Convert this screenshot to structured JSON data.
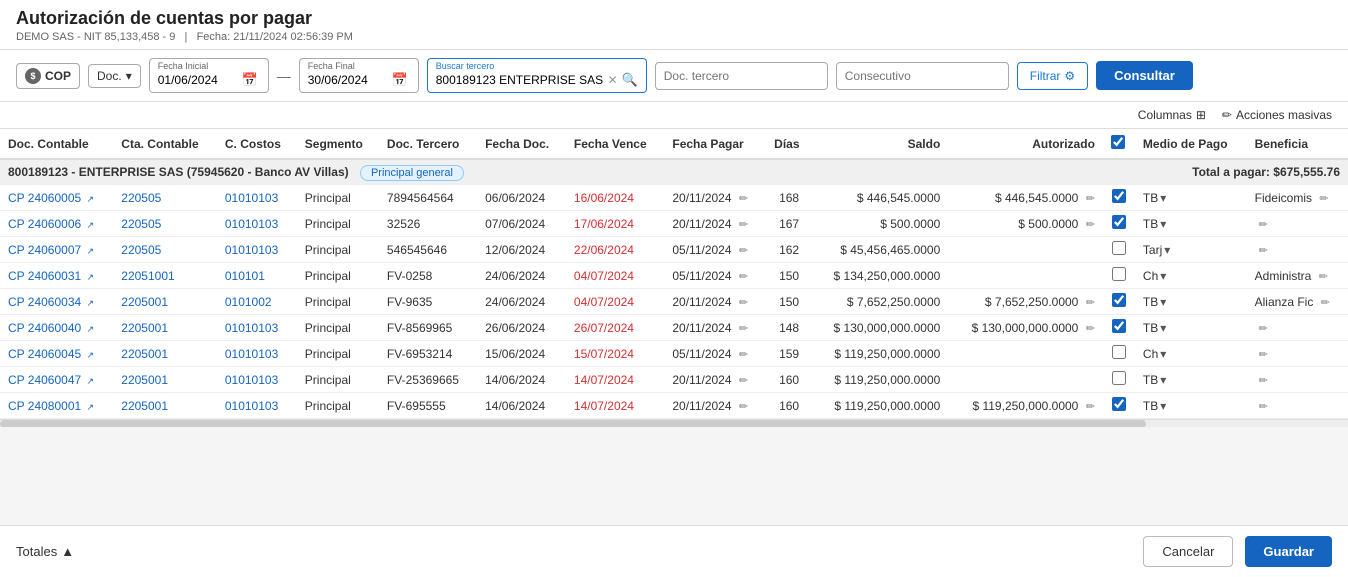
{
  "page": {
    "title": "Autorización de cuentas por pagar",
    "subtitle_company": "DEMO SAS - NIT 85,133,458 - 9",
    "subtitle_date": "Fecha: 21/11/2024 02:56:39 PM"
  },
  "toolbar": {
    "currency": "COP",
    "doc_type": "Doc.",
    "fecha_inicial_label": "Fecha Inicial",
    "fecha_inicial_value": "01/06/2024",
    "fecha_final_label": "Fecha Final",
    "fecha_final_value": "30/06/2024",
    "buscar_tercero_label": "Buscar tercero",
    "buscar_tercero_value": "800189123 ENTERPRISE SAS",
    "doc_tercero_placeholder": "Doc. tercero",
    "consecutivo_placeholder": "Consecutivo",
    "filtrar_label": "Filtrar",
    "consultar_label": "Consultar"
  },
  "action_bar": {
    "columns_label": "Columnas",
    "acciones_label": "Acciones masivas"
  },
  "table": {
    "columns": [
      "Doc. Contable",
      "Cta. Contable",
      "C. Costos",
      "Segmento",
      "Doc. Tercero",
      "Fecha Doc.",
      "Fecha Vence",
      "Fecha Pagar",
      "Días",
      "Saldo",
      "Autorizado",
      "",
      "Medio de Pago",
      "Beneficia"
    ],
    "group": {
      "label": "800189123 - ENTERPRISE SAS (75945620 - Banco AV Villas)",
      "badge": "Principal general",
      "total": "Total a pagar: $675,555.76"
    },
    "rows": [
      {
        "doc_contable": "CP 24060005",
        "cta_contable": "220505",
        "c_costos": "01010103",
        "segmento": "Principal",
        "doc_tercero": "7894564564",
        "fecha_doc": "06/06/2024",
        "fecha_vence": "16/06/2024",
        "fecha_vence_red": true,
        "fecha_pagar": "20/11/2024",
        "dias": "168",
        "saldo": "$ 446,545.0000",
        "autorizado": "$ 446,545.0000",
        "checked": true,
        "medio_pago": "TB",
        "beneficia": "Fideicomis"
      },
      {
        "doc_contable": "CP 24060006",
        "cta_contable": "220505",
        "c_costos": "01010103",
        "segmento": "Principal",
        "doc_tercero": "32526",
        "fecha_doc": "07/06/2024",
        "fecha_vence": "17/06/2024",
        "fecha_vence_red": true,
        "fecha_pagar": "20/11/2024",
        "dias": "167",
        "saldo": "$ 500.0000",
        "autorizado": "$ 500.0000",
        "checked": true,
        "medio_pago": "TB",
        "beneficia": ""
      },
      {
        "doc_contable": "CP 24060007",
        "cta_contable": "220505",
        "c_costos": "01010103",
        "segmento": "Principal",
        "doc_tercero": "546545646",
        "fecha_doc": "12/06/2024",
        "fecha_vence": "22/06/2024",
        "fecha_vence_red": true,
        "fecha_pagar": "05/11/2024",
        "dias": "162",
        "saldo": "$ 45,456,465.0000",
        "autorizado": "",
        "checked": false,
        "medio_pago": "Tarj",
        "beneficia": ""
      },
      {
        "doc_contable": "CP 24060031",
        "cta_contable": "22051001",
        "c_costos": "010101",
        "segmento": "Principal",
        "doc_tercero": "FV-0258",
        "fecha_doc": "24/06/2024",
        "fecha_vence": "04/07/2024",
        "fecha_vence_red": true,
        "fecha_pagar": "05/11/2024",
        "dias": "150",
        "saldo": "$ 134,250,000.0000",
        "autorizado": "",
        "checked": false,
        "medio_pago": "Ch",
        "beneficia": "Administra"
      },
      {
        "doc_contable": "CP 24060034",
        "cta_contable": "2205001",
        "c_costos": "0101002",
        "segmento": "Principal",
        "doc_tercero": "FV-9635",
        "fecha_doc": "24/06/2024",
        "fecha_vence": "04/07/2024",
        "fecha_vence_red": true,
        "fecha_pagar": "20/11/2024",
        "dias": "150",
        "saldo": "$ 7,652,250.0000",
        "autorizado": "$ 7,652,250.0000",
        "checked": true,
        "medio_pago": "TB",
        "beneficia": "Alianza Fic"
      },
      {
        "doc_contable": "CP 24060040",
        "cta_contable": "2205001",
        "c_costos": "01010103",
        "segmento": "Principal",
        "doc_tercero": "FV-8569965",
        "fecha_doc": "26/06/2024",
        "fecha_vence": "26/07/2024",
        "fecha_vence_red": true,
        "fecha_pagar": "20/11/2024",
        "dias": "148",
        "saldo": "$ 130,000,000.0000",
        "autorizado": "$ 130,000,000.0000",
        "checked": true,
        "medio_pago": "TB",
        "beneficia": ""
      },
      {
        "doc_contable": "CP 24060045",
        "cta_contable": "2205001",
        "c_costos": "01010103",
        "segmento": "Principal",
        "doc_tercero": "FV-6953214",
        "fecha_doc": "15/06/2024",
        "fecha_vence": "15/07/2024",
        "fecha_vence_red": true,
        "fecha_pagar": "05/11/2024",
        "dias": "159",
        "saldo": "$ 119,250,000.0000",
        "autorizado": "",
        "checked": false,
        "medio_pago": "Ch",
        "beneficia": ""
      },
      {
        "doc_contable": "CP 24060047",
        "cta_contable": "2205001",
        "c_costos": "01010103",
        "segmento": "Principal",
        "doc_tercero": "FV-25369665",
        "fecha_doc": "14/06/2024",
        "fecha_vence": "14/07/2024",
        "fecha_vence_red": true,
        "fecha_pagar": "20/11/2024",
        "dias": "160",
        "saldo": "$ 119,250,000.0000",
        "autorizado": "",
        "checked": false,
        "medio_pago": "TB",
        "beneficia": ""
      },
      {
        "doc_contable": "CP 24080001",
        "cta_contable": "2205001",
        "c_costos": "01010103",
        "segmento": "Principal",
        "doc_tercero": "FV-695555",
        "fecha_doc": "14/06/2024",
        "fecha_vence": "14/07/2024",
        "fecha_vence_red": true,
        "fecha_pagar": "20/11/2024",
        "dias": "160",
        "saldo": "$ 119,250,000.0000",
        "autorizado": "$ 119,250,000.0000",
        "checked": true,
        "medio_pago": "TB",
        "beneficia": ""
      }
    ]
  },
  "footer": {
    "totales_label": "Totales",
    "cancel_label": "Cancelar",
    "save_label": "Guardar"
  }
}
